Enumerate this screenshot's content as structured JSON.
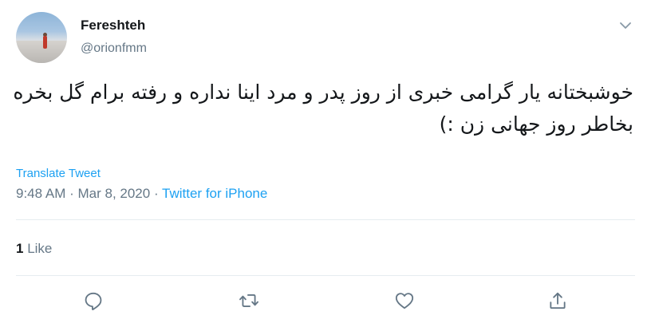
{
  "user": {
    "name": "Fereshteh",
    "handle": "@orionfmm"
  },
  "tweet": {
    "text": "خوشبختانه یار گرامی خبری از روز پدر و مرد اینا نداره و رفته برام گل بخره بخاطر روز جهانی زن :)",
    "translate_label": "Translate Tweet",
    "time": "9:48 AM",
    "sep1": " · ",
    "date": "Mar 8, 2020",
    "sep2": " · ",
    "source": "Twitter for iPhone"
  },
  "stats": {
    "like_count": "1",
    "like_label": "Like"
  },
  "actions": [
    "reply-icon",
    "retweet-icon",
    "like-icon",
    "share-icon"
  ],
  "colors": {
    "accent": "#1da1f2",
    "secondary_text": "#657786",
    "divider": "#e6ecf0"
  }
}
